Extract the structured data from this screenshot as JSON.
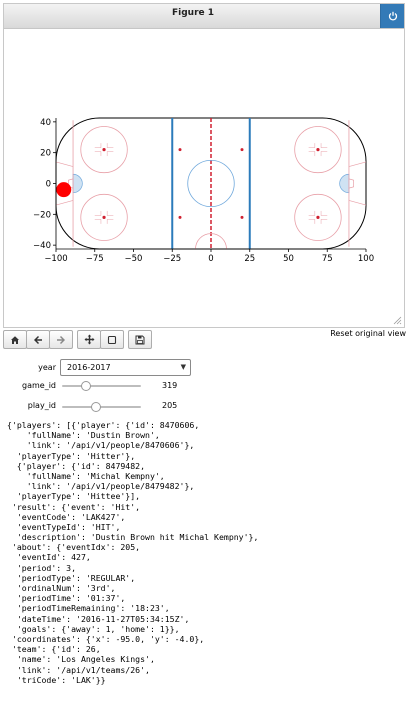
{
  "figure": {
    "title": "Figure 1",
    "power_icon": "power-icon"
  },
  "chart_data": {
    "type": "scatter",
    "title": "",
    "xlabel": "",
    "ylabel": "",
    "xlim": [
      -100,
      100
    ],
    "ylim": [
      -42.5,
      42.5
    ],
    "x_ticks": [
      -100,
      -75,
      -50,
      -25,
      0,
      25,
      50,
      75,
      100
    ],
    "y_ticks": [
      -40,
      -20,
      0,
      20,
      40
    ],
    "x_tick_labels": [
      "−100",
      "−75",
      "−50",
      "−25",
      "0",
      "25",
      "50",
      "75",
      "100"
    ],
    "y_tick_labels": [
      "−40",
      "−20",
      "0",
      "20",
      "40"
    ],
    "background": "hockey rink",
    "points": [
      {
        "x": -95.0,
        "y": -4.0,
        "color": "#ff0000"
      }
    ]
  },
  "toolbar": {
    "buttons": [
      {
        "name": "home",
        "icon": "home-icon"
      },
      {
        "name": "back",
        "icon": "arrow-left-icon"
      },
      {
        "name": "forward",
        "icon": "arrow-right-icon"
      },
      {
        "name": "pan",
        "icon": "move-icon"
      },
      {
        "name": "zoom",
        "icon": "square-icon"
      },
      {
        "name": "save",
        "icon": "floppy-disk-icon"
      }
    ],
    "reset_label": "Reset original view"
  },
  "controls": {
    "year": {
      "label": "year",
      "value": "2016-2017"
    },
    "game_id": {
      "label": "game_id",
      "value": "319",
      "fraction": 0.3
    },
    "play_id": {
      "label": "play_id",
      "value": "205",
      "fraction": 0.43
    }
  },
  "output_lines": [
    "{'players': [{'player': {'id': 8470606,",
    "    'fullName': 'Dustin Brown',",
    "    'link': '/api/v1/people/8470606'},",
    "  'playerType': 'Hitter'},",
    "  {'player': {'id': 8479482,",
    "    'fullName': 'Michal Kempny',",
    "    'link': '/api/v1/people/8479482'},",
    "  'playerType': 'Hittee'}],",
    " 'result': {'event': 'Hit',",
    "  'eventCode': 'LAK427',",
    "  'eventTypeId': 'HIT',",
    "  'description': 'Dustin Brown hit Michal Kempny'},",
    " 'about': {'eventIdx': 205,",
    "  'eventId': 427,",
    "  'period': 3,",
    "  'periodType': 'REGULAR',",
    "  'ordinalNum': '3rd',",
    "  'periodTime': '01:37',",
    "  'periodTimeRemaining': '18:23',",
    "  'dateTime': '2016-11-27T05:34:15Z',",
    "  'goals': {'away': 1, 'home': 1}},",
    " 'coordinates': {'x': -95.0, 'y': -4.0},",
    " 'team': {'id': 26,",
    "  'name': 'Los Angeles Kings',",
    "  'link': '/api/v1/teams/26',",
    "  'triCode': 'LAK'}}"
  ]
}
